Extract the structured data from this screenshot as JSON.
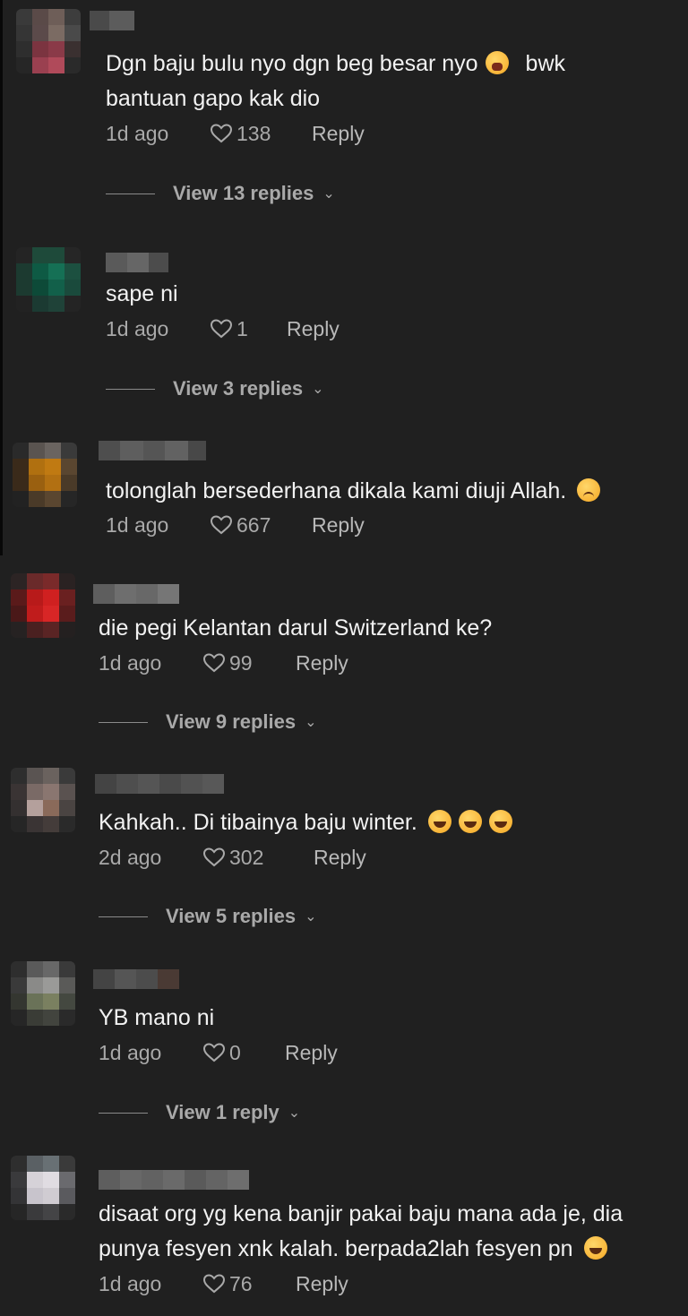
{
  "comments": [
    {
      "text_line1": "Dgn baju bulu nyo dgn beg besar nyo",
      "text_line1_tail": "bwk",
      "text_line2": "bantuan gapo kak dio",
      "time": "1d ago",
      "likes": "138",
      "reply": "Reply",
      "view": "View 13 replies",
      "emoji_icon": "tired-face-emoji"
    },
    {
      "text_line1": "sape ni",
      "time": "1d ago",
      "likes": "1",
      "reply": "Reply",
      "view": "View 3 replies"
    },
    {
      "text_line1": "tolonglah bersederhana dikala kami diuji Allah.",
      "time": "1d ago",
      "likes": "667",
      "reply": "Reply",
      "emoji_icon": "disappointed-face-emoji"
    },
    {
      "text_line1": "die pegi Kelantan darul Switzerland ke?",
      "time": "1d ago",
      "likes": "99",
      "reply": "Reply",
      "view": "View 9 replies"
    },
    {
      "text_line1": "Kahkah.. Di tibainya baju winter.",
      "time": "2d ago",
      "likes": "302",
      "reply": "Reply",
      "view": "View 5 replies",
      "emoji_icon": "rolling-laughing-emoji"
    },
    {
      "text_line1": "YB mano ni",
      "time": "1d ago",
      "likes": "0",
      "reply": "Reply",
      "view": "View 1 reply"
    },
    {
      "text_line1": "disaat org yg kena banjir pakai baju mana ada je, dia",
      "text_line2": "punya fesyen xnk kalah. berpada2lah fesyen pn",
      "time": "1d ago",
      "likes": "76",
      "reply": "Reply",
      "emoji_icon": "tears-of-joy-emoji"
    }
  ],
  "colors": {
    "background": "#202020",
    "text": "#f2f2f2",
    "meta": "#a9a9a9"
  }
}
